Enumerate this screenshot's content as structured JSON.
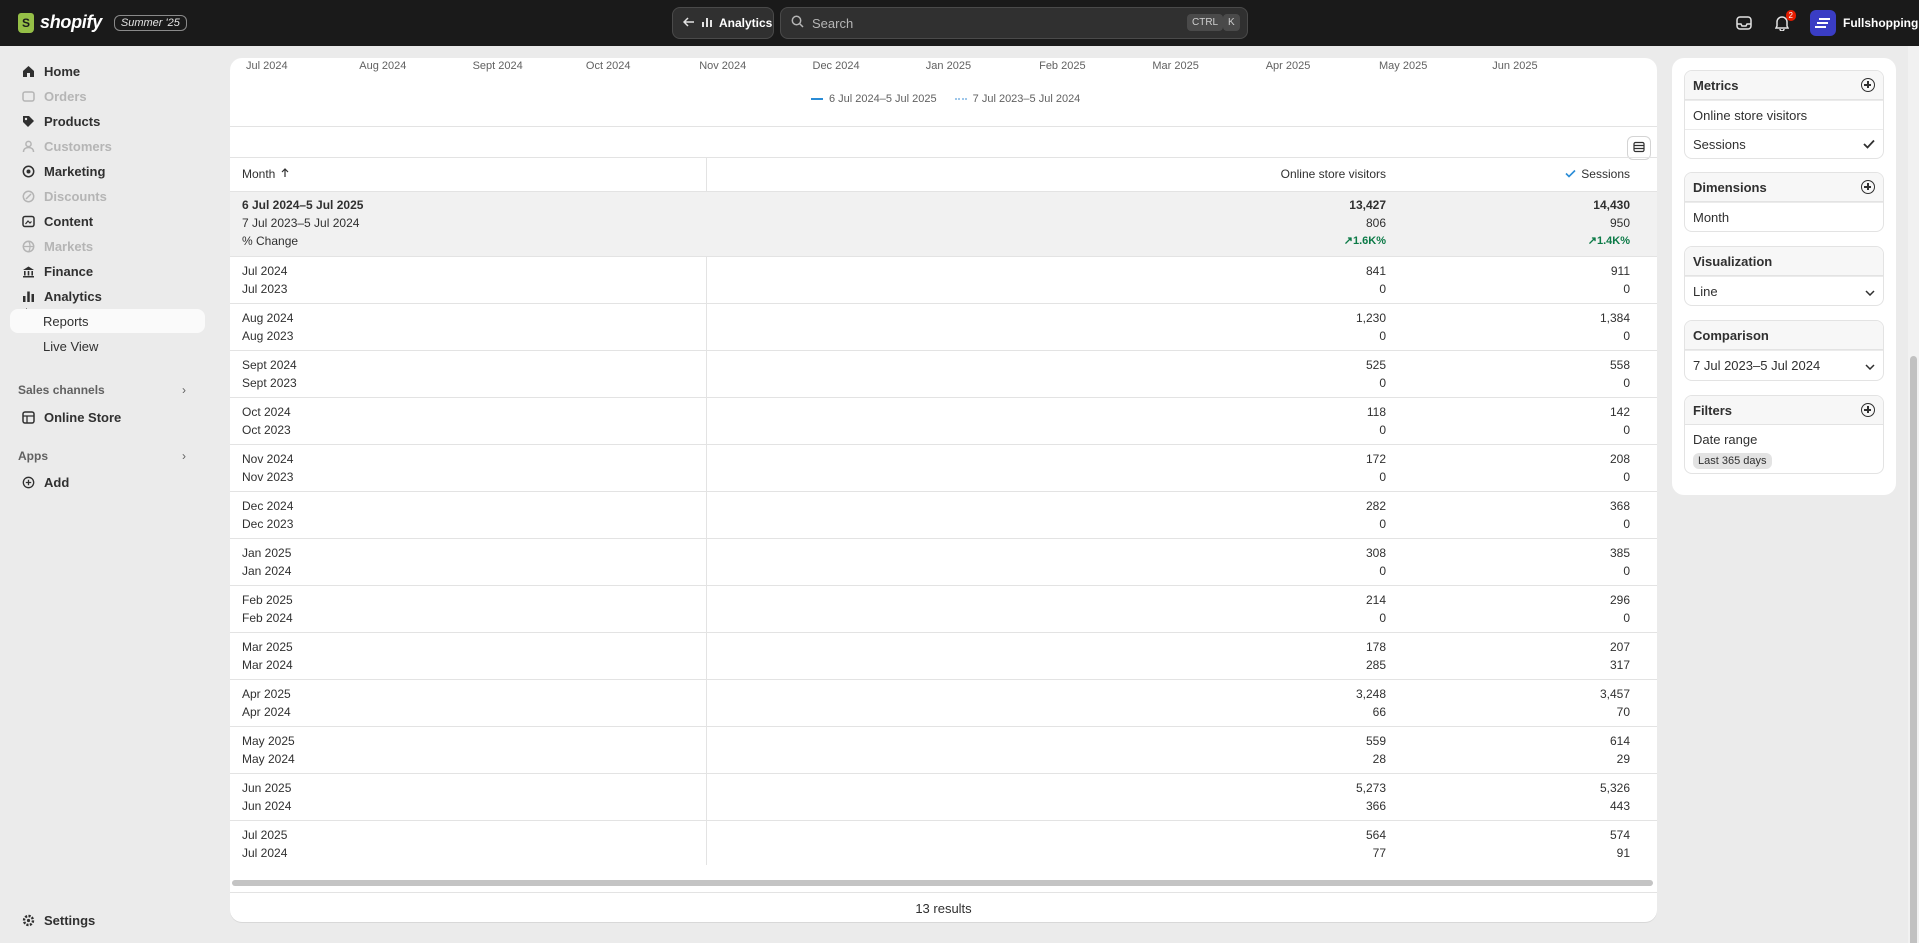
{
  "topbar": {
    "brand": "shopify",
    "edition": "Summer '25",
    "back_label": "Analytics",
    "search_placeholder": "Search",
    "kbd_ctrl": "CTRL",
    "kbd_k": "K",
    "notifications_count": "2",
    "store_name": "Fullshopping"
  },
  "sidebar": {
    "items": [
      {
        "label": "Home",
        "icon": "home-icon",
        "disabled": false
      },
      {
        "label": "Orders",
        "icon": "orders-icon",
        "disabled": true
      },
      {
        "label": "Products",
        "icon": "tag-icon",
        "disabled": false
      },
      {
        "label": "Customers",
        "icon": "person-icon",
        "disabled": true
      },
      {
        "label": "Marketing",
        "icon": "target-icon",
        "disabled": false
      },
      {
        "label": "Discounts",
        "icon": "discount-icon",
        "disabled": true
      },
      {
        "label": "Content",
        "icon": "content-icon",
        "disabled": false
      },
      {
        "label": "Markets",
        "icon": "globe-icon",
        "disabled": true
      },
      {
        "label": "Finance",
        "icon": "bank-icon",
        "disabled": false
      },
      {
        "label": "Analytics",
        "icon": "bar-chart-icon",
        "disabled": false
      }
    ],
    "sub_reports": "Reports",
    "sub_live": "Live View",
    "sales_channels": "Sales channels",
    "online_store": "Online Store",
    "apps": "Apps",
    "add": "Add",
    "settings": "Settings"
  },
  "chart_axis": {
    "months": [
      "Jul 2024",
      "Aug 2024",
      "Sept 2024",
      "Oct 2024",
      "Nov 2024",
      "Dec 2024",
      "Jan 2025",
      "Feb 2025",
      "Mar 2025",
      "Apr 2025",
      "May 2025",
      "Jun 2025"
    ],
    "legend_current": "6 Jul 2024–5 Jul 2025",
    "legend_previous": "7 Jul 2023–5 Jul 2024",
    "current_color": "#2a8cd6",
    "previous_color": "#9ec7ea"
  },
  "table": {
    "headers": {
      "month": "Month",
      "visitors": "Online store visitors",
      "sessions": "Sessions"
    },
    "summary": {
      "line1": "6 Jul 2024–5 Jul 2025",
      "line2": "7 Jul 2023–5 Jul 2024",
      "line3": "% Change",
      "visitors": [
        "13,427",
        "806",
        "1.6K%"
      ],
      "sessions": [
        "14,430",
        "950",
        "1.4K%"
      ]
    },
    "rows": [
      {
        "m1": "Jul 2024",
        "m2": "Jul 2023",
        "v1": "841",
        "v2": "0",
        "s1": "911",
        "s2": "0"
      },
      {
        "m1": "Aug 2024",
        "m2": "Aug 2023",
        "v1": "1,230",
        "v2": "0",
        "s1": "1,384",
        "s2": "0"
      },
      {
        "m1": "Sept 2024",
        "m2": "Sept 2023",
        "v1": "525",
        "v2": "0",
        "s1": "558",
        "s2": "0"
      },
      {
        "m1": "Oct 2024",
        "m2": "Oct 2023",
        "v1": "118",
        "v2": "0",
        "s1": "142",
        "s2": "0"
      },
      {
        "m1": "Nov 2024",
        "m2": "Nov 2023",
        "v1": "172",
        "v2": "0",
        "s1": "208",
        "s2": "0"
      },
      {
        "m1": "Dec 2024",
        "m2": "Dec 2023",
        "v1": "282",
        "v2": "0",
        "s1": "368",
        "s2": "0"
      },
      {
        "m1": "Jan 2025",
        "m2": "Jan 2024",
        "v1": "308",
        "v2": "0",
        "s1": "385",
        "s2": "0"
      },
      {
        "m1": "Feb 2025",
        "m2": "Feb 2024",
        "v1": "214",
        "v2": "0",
        "s1": "296",
        "s2": "0"
      },
      {
        "m1": "Mar 2025",
        "m2": "Mar 2024",
        "v1": "178",
        "v2": "285",
        "s1": "207",
        "s2": "317"
      },
      {
        "m1": "Apr 2025",
        "m2": "Apr 2024",
        "v1": "3,248",
        "v2": "66",
        "s1": "3,457",
        "s2": "70"
      },
      {
        "m1": "May 2025",
        "m2": "May 2024",
        "v1": "559",
        "v2": "28",
        "s1": "614",
        "s2": "29"
      },
      {
        "m1": "Jun 2025",
        "m2": "Jun 2024",
        "v1": "5,273",
        "v2": "366",
        "s1": "5,326",
        "s2": "443"
      },
      {
        "m1": "Jul 2025",
        "m2": "Jul 2024",
        "v1": "564",
        "v2": "77",
        "s1": "574",
        "s2": "91"
      }
    ],
    "results": "13 results"
  },
  "panel": {
    "metrics_title": "Metrics",
    "metric_1": "Online store visitors",
    "metric_2": "Sessions",
    "dimensions_title": "Dimensions",
    "dimension_1": "Month",
    "visualization_title": "Visualization",
    "visualization_value": "Line",
    "comparison_title": "Comparison",
    "comparison_value": "7 Jul 2023–5 Jul 2024",
    "filters_title": "Filters",
    "filter_label": "Date range",
    "filter_value": "Last 365 days"
  }
}
